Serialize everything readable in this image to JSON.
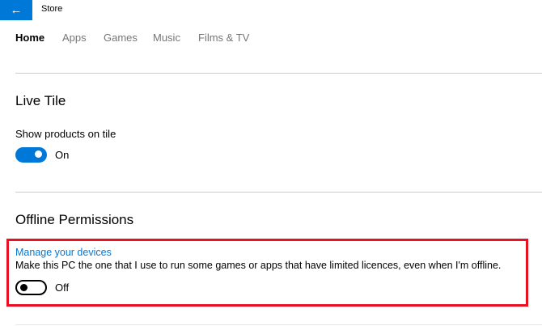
{
  "titlebar": {
    "back_icon": "arrow-left-icon",
    "title": "Store"
  },
  "tabs": [
    {
      "label": "Home",
      "active": true
    },
    {
      "label": "Apps"
    },
    {
      "label": "Games"
    },
    {
      "label": "Music"
    },
    {
      "label": "Films & TV"
    }
  ],
  "live_tile": {
    "heading": "Live Tile",
    "setting_label": "Show products on tile",
    "toggle_state": "On"
  },
  "offline": {
    "heading": "Offline Permissions",
    "link": "Manage your devices",
    "description": "Make this PC the one that I use to run some games or apps that have limited licences, even when I'm offline.",
    "toggle_state": "Off"
  },
  "colors": {
    "accent": "#0078d7",
    "highlight": "#e81123"
  }
}
